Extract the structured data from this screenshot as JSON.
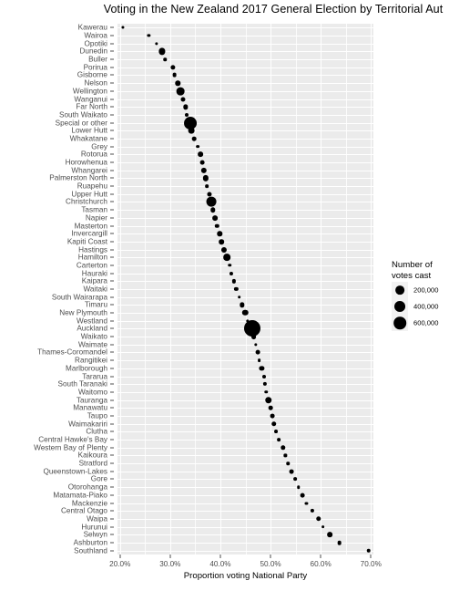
{
  "chart_data": {
    "type": "scatter",
    "title": "Voting in the New Zealand 2017 General Election by Territorial Aut",
    "xlabel": "Proportion voting National Party",
    "ylabel": "",
    "xlim": [
      0.195,
      0.705
    ],
    "xticks": [
      0.2,
      0.3,
      0.4,
      0.5,
      0.6,
      0.7
    ],
    "xticklabels": [
      "20.0%",
      "30.0%",
      "40.0%",
      "50.0%",
      "60.0%",
      "70.0%"
    ],
    "grid": true,
    "legend": {
      "title": "Number of votes cast",
      "title_lines": [
        "Number of",
        "votes cast"
      ],
      "position": "right",
      "entries": [
        {
          "label": "200,000",
          "value": 200000
        },
        {
          "label": "400,000",
          "value": 400000
        },
        {
          "label": "600,000",
          "value": 600000
        }
      ]
    },
    "size_encoding": "votes_cast",
    "categories": [
      "Kawerau",
      "Wairoa",
      "Opotiki",
      "Dunedin",
      "Buller",
      "Porirua",
      "Gisborne",
      "Nelson",
      "Wellington",
      "Wanganui",
      "Far North",
      "South Waikato",
      "Special or other",
      "Lower Hutt",
      "Whakatane",
      "Grey",
      "Rotorua",
      "Horowhenua",
      "Whangarei",
      "Palmerston North",
      "Ruapehu",
      "Upper Hutt",
      "Christchurch",
      "Tasman",
      "Napier",
      "Masterton",
      "Invercargill",
      "Kapiti Coast",
      "Hastings",
      "Hamilton",
      "Carterton",
      "Hauraki",
      "Kaipara",
      "Waitaki",
      "South Wairarapa",
      "Timaru",
      "New Plymouth",
      "Westland",
      "Auckland",
      "Waikato",
      "Waimate",
      "Thames-Coromandel",
      "Rangitikei",
      "Marlborough",
      "Tararua",
      "South Taranaki",
      "Waitomo",
      "Tauranga",
      "Manawatu",
      "Taupo",
      "Waimakariri",
      "Clutha",
      "Central Hawke's Bay",
      "Western Bay of Plenty",
      "Kaikoura",
      "Stratford",
      "Queenstown-Lakes",
      "Gore",
      "Otorohanga",
      "Matamata-Piako",
      "Mackenzie",
      "Central Otago",
      "Waipa",
      "Hurunui",
      "Selwyn",
      "Ashburton",
      "Southland"
    ],
    "points": [
      {
        "label": "Kawerau",
        "x": 0.2055,
        "votes": 3500
      },
      {
        "label": "Wairoa",
        "x": 0.2575,
        "votes": 4200
      },
      {
        "label": "Opotiki",
        "x": 0.2725,
        "votes": 4600
      },
      {
        "label": "Dunedin",
        "x": 0.2845,
        "votes": 74000
      },
      {
        "label": "Buller",
        "x": 0.2895,
        "votes": 6200
      },
      {
        "label": "Porirua",
        "x": 0.3055,
        "votes": 29000
      },
      {
        "label": "Gisborne",
        "x": 0.3085,
        "votes": 21000
      },
      {
        "label": "Nelson",
        "x": 0.3155,
        "votes": 32000
      },
      {
        "label": "Wellington",
        "x": 0.3205,
        "votes": 123000
      },
      {
        "label": "Wanganui",
        "x": 0.3255,
        "votes": 26000
      },
      {
        "label": "Far North",
        "x": 0.3305,
        "votes": 31000
      },
      {
        "label": "South Waikato",
        "x": 0.3335,
        "votes": 11000
      },
      {
        "label": "Special or other",
        "x": 0.3395,
        "votes": 390000
      },
      {
        "label": "Lower Hutt",
        "x": 0.3425,
        "votes": 62000
      },
      {
        "label": "Whakatane",
        "x": 0.3475,
        "votes": 19000
      },
      {
        "label": "Grey",
        "x": 0.3545,
        "votes": 8200
      },
      {
        "label": "Rotorua",
        "x": 0.3605,
        "votes": 38000
      },
      {
        "label": "Horowhenua",
        "x": 0.3645,
        "votes": 21000
      },
      {
        "label": "Whangarei",
        "x": 0.3675,
        "votes": 52000
      },
      {
        "label": "Palmerston North",
        "x": 0.3705,
        "votes": 50000
      },
      {
        "label": "Ruapehu",
        "x": 0.3735,
        "votes": 7500
      },
      {
        "label": "Upper Hutt",
        "x": 0.3775,
        "votes": 26000
      },
      {
        "label": "Christchurch",
        "x": 0.3815,
        "votes": 215000
      },
      {
        "label": "Tasman",
        "x": 0.3855,
        "votes": 33000
      },
      {
        "label": "Napier",
        "x": 0.3895,
        "votes": 39000
      },
      {
        "label": "Masterton",
        "x": 0.3935,
        "votes": 16000
      },
      {
        "label": "Invercargill",
        "x": 0.3985,
        "votes": 32000
      },
      {
        "label": "Kapiti Coast",
        "x": 0.4025,
        "votes": 36000
      },
      {
        "label": "Hastings",
        "x": 0.4075,
        "votes": 46000
      },
      {
        "label": "Hamilton",
        "x": 0.4135,
        "votes": 88000
      },
      {
        "label": "Carterton",
        "x": 0.4185,
        "votes": 6300
      },
      {
        "label": "Hauraki",
        "x": 0.4225,
        "votes": 12000
      },
      {
        "label": "Kaipara",
        "x": 0.4265,
        "votes": 14000
      },
      {
        "label": "Waitaki",
        "x": 0.4315,
        "votes": 14000
      },
      {
        "label": "South Wairarapa",
        "x": 0.4375,
        "votes": 7200
      },
      {
        "label": "Timaru",
        "x": 0.4435,
        "votes": 31000
      },
      {
        "label": "New Plymouth",
        "x": 0.4495,
        "votes": 54000
      },
      {
        "label": "Westland",
        "x": 0.4545,
        "votes": 5300
      },
      {
        "label": "Auckland",
        "x": 0.4635,
        "votes": 700000
      },
      {
        "label": "Waikato",
        "x": 0.4665,
        "votes": 41000
      },
      {
        "label": "Waimate",
        "x": 0.4705,
        "votes": 5000
      },
      {
        "label": "Thames-Coromandel",
        "x": 0.4745,
        "votes": 21000
      },
      {
        "label": "Rangitikei",
        "x": 0.4775,
        "votes": 9000
      },
      {
        "label": "Marlborough",
        "x": 0.4825,
        "votes": 28000
      },
      {
        "label": "Tararua",
        "x": 0.4865,
        "votes": 11000
      },
      {
        "label": "South Taranaki",
        "x": 0.4885,
        "votes": 14000
      },
      {
        "label": "Waitomo",
        "x": 0.4915,
        "votes": 6000
      },
      {
        "label": "Tauranga",
        "x": 0.4955,
        "votes": 82000
      },
      {
        "label": "Manawatu",
        "x": 0.5005,
        "votes": 19000
      },
      {
        "label": "Taupo",
        "x": 0.5035,
        "votes": 22000
      },
      {
        "label": "Waimakariri",
        "x": 0.5065,
        "votes": 34000
      },
      {
        "label": "Clutha",
        "x": 0.5105,
        "votes": 10000
      },
      {
        "label": "Central Hawke's Bay",
        "x": 0.5165,
        "votes": 8500
      },
      {
        "label": "Western Bay of Plenty",
        "x": 0.5245,
        "votes": 32000
      },
      {
        "label": "Kaikoura",
        "x": 0.5295,
        "votes": 4300
      },
      {
        "label": "Stratford",
        "x": 0.5345,
        "votes": 5800
      },
      {
        "label": "Queenstown-Lakes",
        "x": 0.5425,
        "votes": 22000
      },
      {
        "label": "Gore",
        "x": 0.5485,
        "votes": 8300
      },
      {
        "label": "Otorohanga",
        "x": 0.5555,
        "votes": 6200
      },
      {
        "label": "Matamata-Piako",
        "x": 0.5635,
        "votes": 21000
      },
      {
        "label": "Mackenzie",
        "x": 0.5715,
        "votes": 3200
      },
      {
        "label": "Central Otago",
        "x": 0.5835,
        "votes": 13000
      },
      {
        "label": "Waipa",
        "x": 0.5955,
        "votes": 33000
      },
      {
        "label": "Hurunui",
        "x": 0.6045,
        "votes": 8500
      },
      {
        "label": "Selwyn",
        "x": 0.6185,
        "votes": 37000
      },
      {
        "label": "Ashburton",
        "x": 0.6375,
        "votes": 19000
      },
      {
        "label": "Southland",
        "x": 0.6955,
        "votes": 17000
      }
    ]
  }
}
